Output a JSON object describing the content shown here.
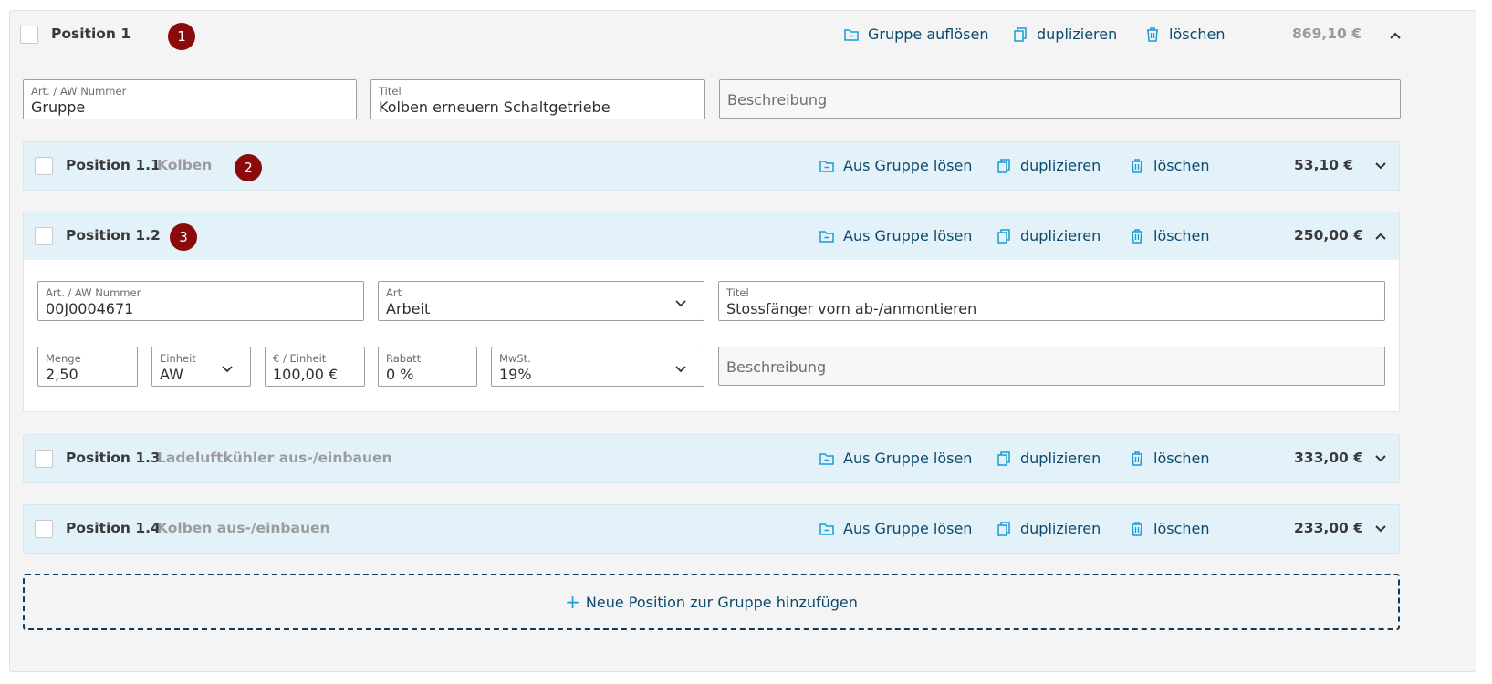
{
  "group": {
    "label": "Position 1",
    "badge": "1",
    "actions": {
      "dissolve": "Gruppe auflösen",
      "duplicate": "duplizieren",
      "delete": "löschen"
    },
    "price": "869,10 €",
    "fields": {
      "art_label": "Art. / AW Nummer",
      "art_value": "Gruppe",
      "title_label": "Titel",
      "title_value": "Kolben erneuern Schaltgetriebe",
      "desc_placeholder": "Beschreibung"
    }
  },
  "positions": [
    {
      "label": "Position 1.1",
      "subtitle": "Kolben",
      "badge": "2",
      "price": "53,10 €"
    },
    {
      "label": "Position 1.2",
      "subtitle": "",
      "badge": "3",
      "price": "250,00 €",
      "fields": {
        "art_label": "Art. / AW Nummer",
        "art_value": "00J0004671",
        "type_label": "Art",
        "type_value": "Arbeit",
        "title_label": "Titel",
        "title_value": "Stossfänger vorn ab-/anmontieren",
        "qty_label": "Menge",
        "qty_value": "2,50",
        "unit_label": "Einheit",
        "unit_value": "AW",
        "ppu_label": "€ / Einheit",
        "ppu_value": "100,00 €",
        "discount_label": "Rabatt",
        "discount_value": "0 %",
        "vat_label": "MwSt.",
        "vat_value": "19%",
        "desc_placeholder": "Beschreibung"
      }
    },
    {
      "label": "Position 1.3",
      "subtitle": "Ladeluftkühler aus-/einbauen",
      "price": "333,00 €"
    },
    {
      "label": "Position 1.4",
      "subtitle": "Kolben aus-/einbauen",
      "price": "233,00 €"
    }
  ],
  "position_actions": {
    "ungroup": "Aus Gruppe lösen",
    "duplicate": "duplizieren",
    "delete": "löschen"
  },
  "add_button": {
    "icon": "+",
    "label": "Neue Position zur Gruppe hinzufügen"
  },
  "colors": {
    "accent": "#0c4a6e",
    "icon": "#1a9bd7",
    "badge": "#8b0a0a",
    "card": "#e3f1f8"
  }
}
